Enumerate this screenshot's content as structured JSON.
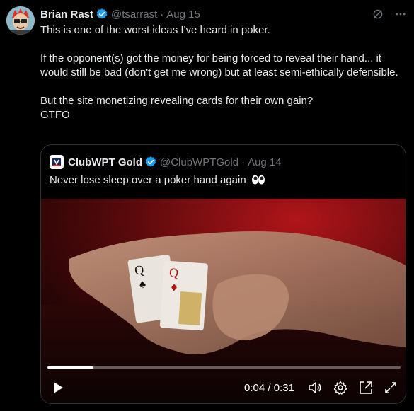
{
  "tweet": {
    "author_name": "Brian Rast",
    "handle": "@tsarrast",
    "separator": "·",
    "date": "Aug 15",
    "paragraphs": [
      "This is one of the worst ideas I've heard in poker.",
      "If the opponent(s) got the money for being forced to reveal their hand... it would still be bad (don't get me wrong) but at least semi-ethically defensible.",
      "But the site monetizing revealing cards for their own gain?\nGTFO"
    ],
    "icons": [
      "avatar",
      "verified-badge-icon",
      "grok-icon",
      "more-icon"
    ]
  },
  "quote": {
    "author_name": "ClubWPT Gold",
    "handle": "@ClubWPTGold",
    "separator": "·",
    "date": "Aug 14",
    "text": "Never lose sleep over a poker hand again",
    "text_emoji": "eyes-emoji",
    "video": {
      "current_time": "0:04",
      "duration": "0:31",
      "timecode": "0:04 / 0:31",
      "progress_fraction": 0.13,
      "icons": [
        "play-icon",
        "volume-icon",
        "settings-icon",
        "popout-icon",
        "fullscreen-icon"
      ]
    }
  },
  "colors": {
    "background": "#000000",
    "text_primary": "#e7e9ea",
    "text_secondary": "#71767b",
    "verified_blue": "#1d9bf0",
    "border": "#2f3336"
  }
}
